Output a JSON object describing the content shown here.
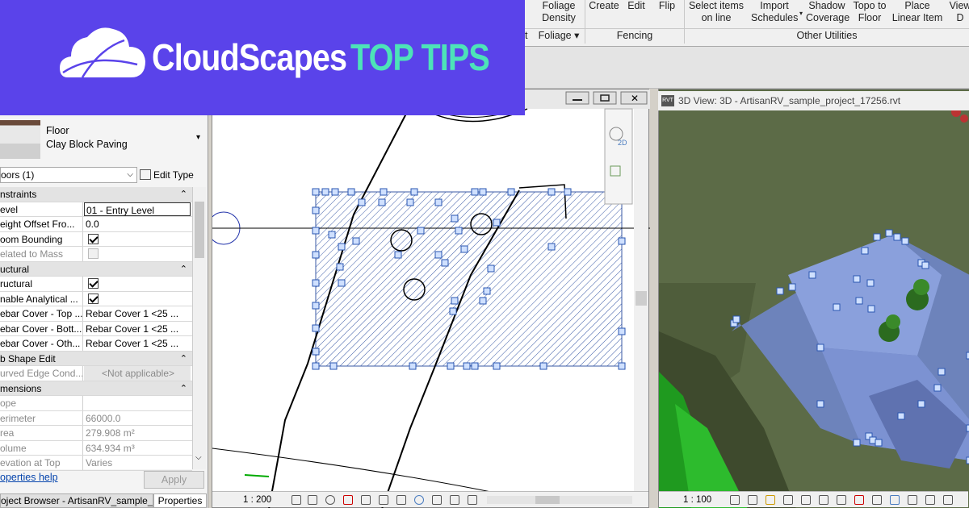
{
  "ribbon": {
    "buttons": [
      {
        "label": "Foliage\nDensity"
      },
      {
        "label": "Create"
      },
      {
        "label": "Edit"
      },
      {
        "label": "Flip"
      },
      {
        "label": "Select items\non line"
      },
      {
        "label": "Import\nSchedules"
      },
      {
        "label": "Shadow\nCoverage"
      },
      {
        "label": "Topo to\nFloor"
      },
      {
        "label": "Place\nLinear Item"
      },
      {
        "label": "View\nD"
      }
    ],
    "groups": {
      "foliage": "Foliage ▾",
      "fencing": "Fencing",
      "other": "Other Utilities",
      "partial": "t"
    }
  },
  "banner": {
    "brand": "CloudScapes",
    "tag": "TOP TIPS",
    "bg": "#5a43ea",
    "tag_color": "#4de3b8"
  },
  "properties": {
    "type_category": "Floor",
    "type_name": "Clay Block Paving",
    "filter": "oors (1)",
    "edit_type": "Edit Type",
    "rows": [
      {
        "kind": "head",
        "label": "nstraints"
      },
      {
        "kind": "row",
        "label": "evel",
        "value": "01 - Entry Level"
      },
      {
        "kind": "row",
        "label": "eight Offset Fro...",
        "value": "0.0"
      },
      {
        "kind": "check",
        "label": "oom Bounding",
        "checked": true
      },
      {
        "kind": "check",
        "label": "elated to Mass",
        "checked": false,
        "disabled": true
      },
      {
        "kind": "head",
        "label": "uctural"
      },
      {
        "kind": "check",
        "label": "ructural",
        "checked": true
      },
      {
        "kind": "check",
        "label": "nable Analytical ...",
        "checked": true
      },
      {
        "kind": "row",
        "label": "ebar Cover - Top ...",
        "value": "Rebar Cover 1 <25 ..."
      },
      {
        "kind": "row",
        "label": "ebar Cover - Bott...",
        "value": "Rebar Cover 1 <25 ..."
      },
      {
        "kind": "row",
        "label": "ebar Cover - Oth...",
        "value": "Rebar Cover 1 <25 ..."
      },
      {
        "kind": "head",
        "label": "b Shape Edit"
      },
      {
        "kind": "row",
        "label": "urved Edge Cond...",
        "value": "<Not applicable>",
        "disabled": true
      },
      {
        "kind": "head",
        "label": "mensions"
      },
      {
        "kind": "row",
        "label": "ope",
        "value": "",
        "disabled": true
      },
      {
        "kind": "row",
        "label": "erimeter",
        "value": "66000.0",
        "disabled": true
      },
      {
        "kind": "row",
        "label": "rea",
        "value": "279.908 m²",
        "disabled": true
      },
      {
        "kind": "row",
        "label": "olume",
        "value": "634.934 m³",
        "disabled": true
      },
      {
        "kind": "row",
        "label": "evation at Top",
        "value": "Varies",
        "disabled": true
      }
    ],
    "help_link": "operties help",
    "apply": "Apply",
    "tabs": [
      "oject Browser - ArtisanRV_sample_...",
      "Properties"
    ]
  },
  "plan_view": {
    "scale": "1 : 200",
    "navbar_2d": "2D"
  },
  "view_3d": {
    "title": "3D View: 3D - ArtisanRV_sample_project_17256.rvt",
    "rvt_badge": "RVT",
    "scale": "1 : 100"
  }
}
